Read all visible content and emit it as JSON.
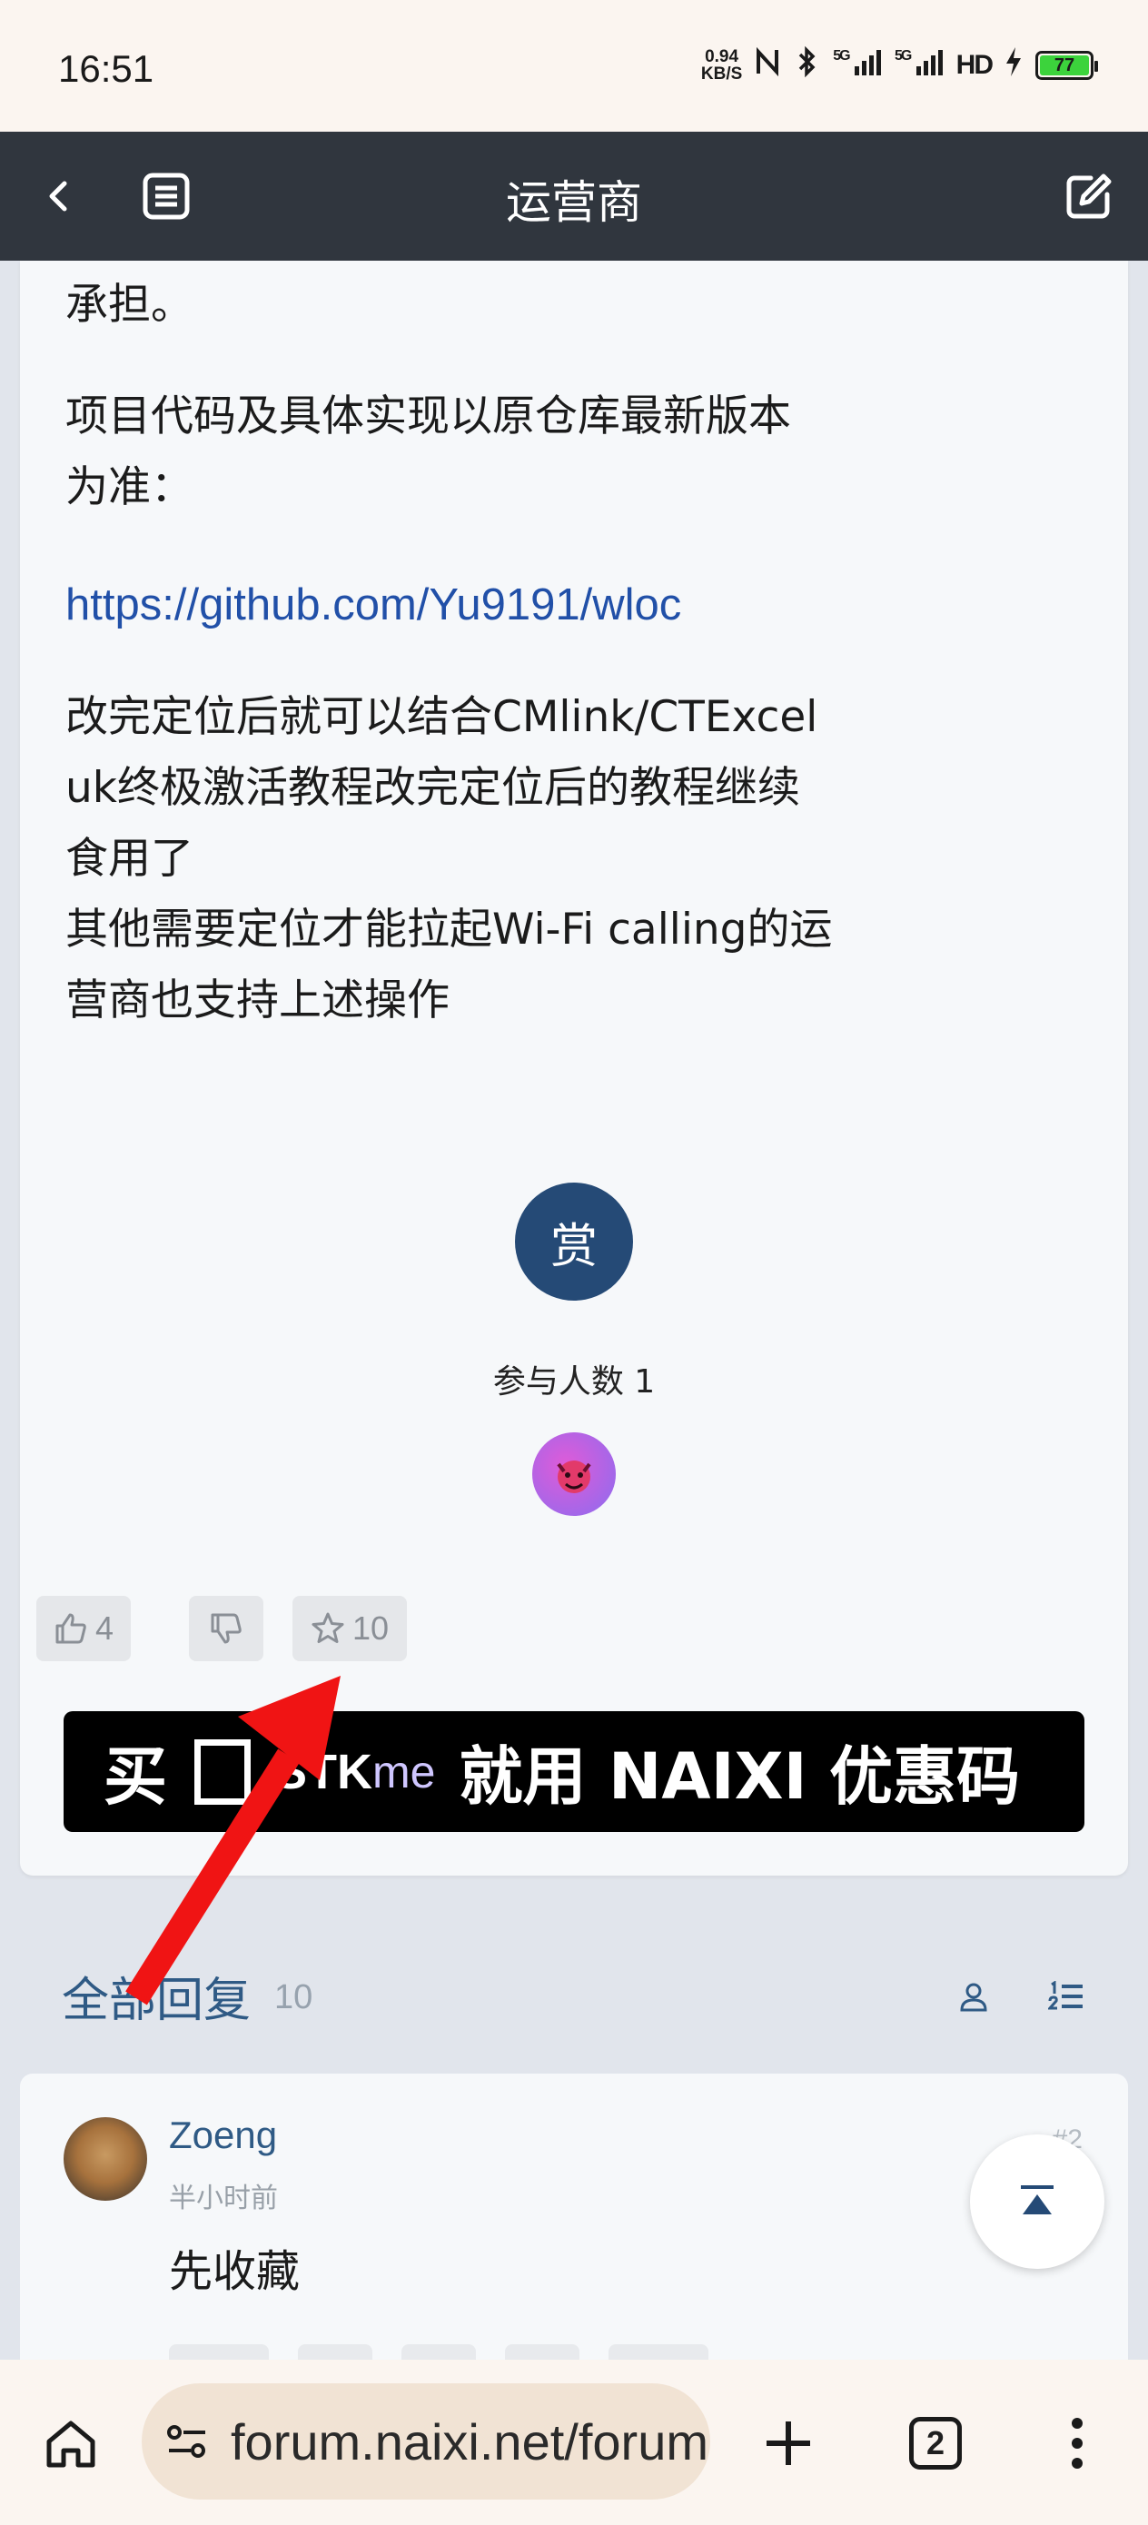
{
  "status_bar": {
    "time": "16:51",
    "net_speed_value": "0.94",
    "net_speed_unit": "KB/S",
    "signal1_label": "5G",
    "signal2_label": "5G",
    "hd_label": "HD",
    "battery_level": "77",
    "battery_color": "#3cd33c"
  },
  "app_bar": {
    "title": "运营商",
    "background": "#30363e",
    "back_icon": "chevron-left-icon",
    "menu_icon": "list-icon",
    "compose_icon": "edit-icon"
  },
  "post": {
    "paragraphs": [
      "承担。",
      "项目代码及具体实现以原仓库最新版本",
      "为准："
    ],
    "link": "https://github.com/Yu9191/wloc",
    "body_lines": [
      "改完定位后就可以结合CMlink/CTExcel",
      "uk终极激活教程改完定位后的教程继续",
      "食用了",
      "其他需要定位才能拉起Wi-Fi calling的运",
      "营商也支持上述操作"
    ],
    "reward_button": "赏",
    "participants_label": "参与人数 1",
    "likes": "4",
    "favorites": "10",
    "banner": {
      "prefix": "买",
      "brand_strong": "STK",
      "brand_light": "me",
      "suffix": "就用 NAIXI 优惠码"
    }
  },
  "replies": {
    "title": "全部回复",
    "count": "10",
    "accent_color": "#2f5a85",
    "items": [
      {
        "author": "Zoeng",
        "time": "半小时前",
        "floor": "#2",
        "content": "先收藏"
      }
    ]
  },
  "browser": {
    "url": "forum.naixi.net/forum",
    "tab_count": "2"
  }
}
